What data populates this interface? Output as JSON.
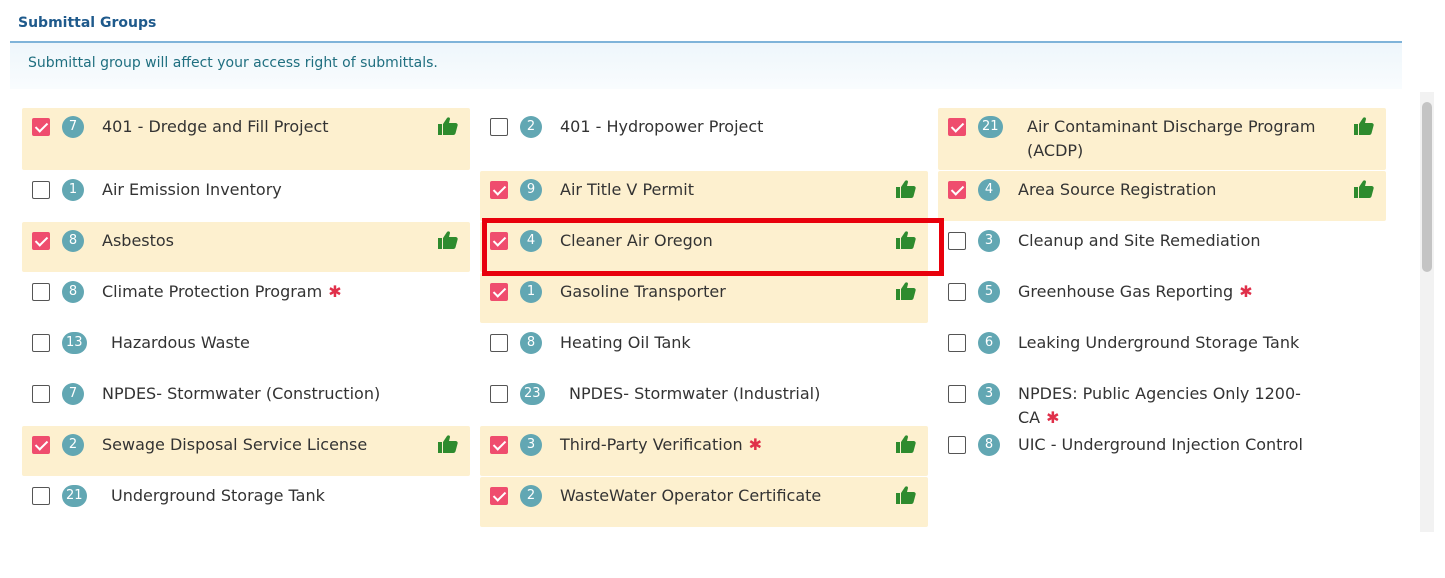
{
  "section": {
    "title": "Submittal Groups",
    "info": "Submittal group will affect your access right of submittals."
  },
  "groups": [
    {
      "label": "401 - Dredge and Fill Project",
      "count": "7",
      "checked": true,
      "required": false
    },
    {
      "label": "401 - Hydropower Project",
      "count": "2",
      "checked": false,
      "required": false
    },
    {
      "label": "Air Contaminant Discharge Program (ACDP)",
      "count": "21",
      "checked": true,
      "required": false
    },
    {
      "label": "Air Emission Inventory",
      "count": "1",
      "checked": false,
      "required": false
    },
    {
      "label": "Air Title V Permit",
      "count": "9",
      "checked": true,
      "required": false
    },
    {
      "label": "Area Source Registration",
      "count": "4",
      "checked": true,
      "required": false
    },
    {
      "label": "Asbestos",
      "count": "8",
      "checked": true,
      "required": false
    },
    {
      "label": "Cleaner Air Oregon",
      "count": "4",
      "checked": true,
      "required": false
    },
    {
      "label": "Cleanup and Site Remediation",
      "count": "3",
      "checked": false,
      "required": false
    },
    {
      "label": "Climate Protection Program",
      "count": "8",
      "checked": false,
      "required": true
    },
    {
      "label": "Gasoline Transporter",
      "count": "1",
      "checked": true,
      "required": false
    },
    {
      "label": "Greenhouse Gas Reporting",
      "count": "5",
      "checked": false,
      "required": true
    },
    {
      "label": "Hazardous Waste",
      "count": "13",
      "checked": false,
      "required": false
    },
    {
      "label": "Heating Oil Tank",
      "count": "8",
      "checked": false,
      "required": false
    },
    {
      "label": "Leaking Underground Storage Tank",
      "count": "6",
      "checked": false,
      "required": false
    },
    {
      "label": "NPDES- Stormwater (Construction)",
      "count": "7",
      "checked": false,
      "required": false
    },
    {
      "label": "NPDES- Stormwater (Industrial)",
      "count": "23",
      "checked": false,
      "required": false
    },
    {
      "label": "NPDES: Public Agencies Only 1200-CA",
      "count": "3",
      "checked": false,
      "required": true
    },
    {
      "label": "Sewage Disposal Service License",
      "count": "2",
      "checked": true,
      "required": false
    },
    {
      "label": "Third-Party Verification",
      "count": "3",
      "checked": true,
      "required": true
    },
    {
      "label": "UIC - Underground Injection Control",
      "count": "8",
      "checked": false,
      "required": false
    },
    {
      "label": "Underground Storage Tank",
      "count": "21",
      "checked": false,
      "required": false
    },
    {
      "label": "WasteWater Operator Certificate",
      "count": "2",
      "checked": true,
      "required": false
    }
  ],
  "symbols": {
    "required": "✱"
  },
  "colors": {
    "checked_bg": "#fdf0cf",
    "checkbox_checked": "#ef4d6e",
    "badge": "#62a7b3",
    "thumb": "#2e8b2e",
    "highlight": "#e8000c",
    "required": "#e0304a"
  },
  "icons": {
    "approved": "thumbs-up-icon",
    "required": "asterisk-icon",
    "checkbox": "checkbox-icon"
  }
}
